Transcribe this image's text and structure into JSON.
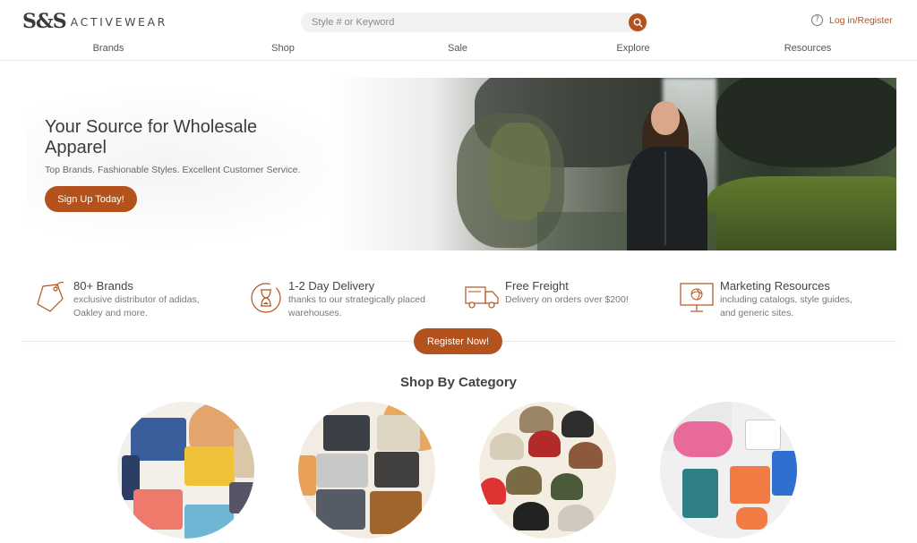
{
  "header": {
    "logo_mark": "S&S",
    "logo_text": "ACTIVEWEAR",
    "search_placeholder": "Style # or Keyword",
    "login_label": "Log in/Register"
  },
  "nav": [
    "Brands",
    "Shop",
    "Sale",
    "Explore",
    "Resources"
  ],
  "hero": {
    "title": "Your Source for Wholesale Apparel",
    "subtitle": "Top Brands. Fashionable Styles. Excellent Customer Service.",
    "cta": "Sign Up Today!"
  },
  "features": [
    {
      "icon": "price-tag-icon",
      "title": "80+ Brands",
      "desc": [
        "exclusive distributor of adidas,",
        "Oakley and more."
      ]
    },
    {
      "icon": "hourglass-icon",
      "title": "1-2 Day Delivery",
      "desc": [
        "thanks to our strategically placed",
        "warehouses."
      ]
    },
    {
      "icon": "truck-icon",
      "title": "Free Freight",
      "desc": [
        "Delivery on orders over $200!"
      ]
    },
    {
      "icon": "monitor-icon",
      "title": "Marketing Resources",
      "desc": [
        "including catalogs, style guides,",
        "and generic sites."
      ]
    }
  ],
  "register_cta": "Register Now!",
  "categories_title": "Shop By Category",
  "colors": {
    "accent": "#b4521d",
    "text": "#3c3c3c"
  }
}
